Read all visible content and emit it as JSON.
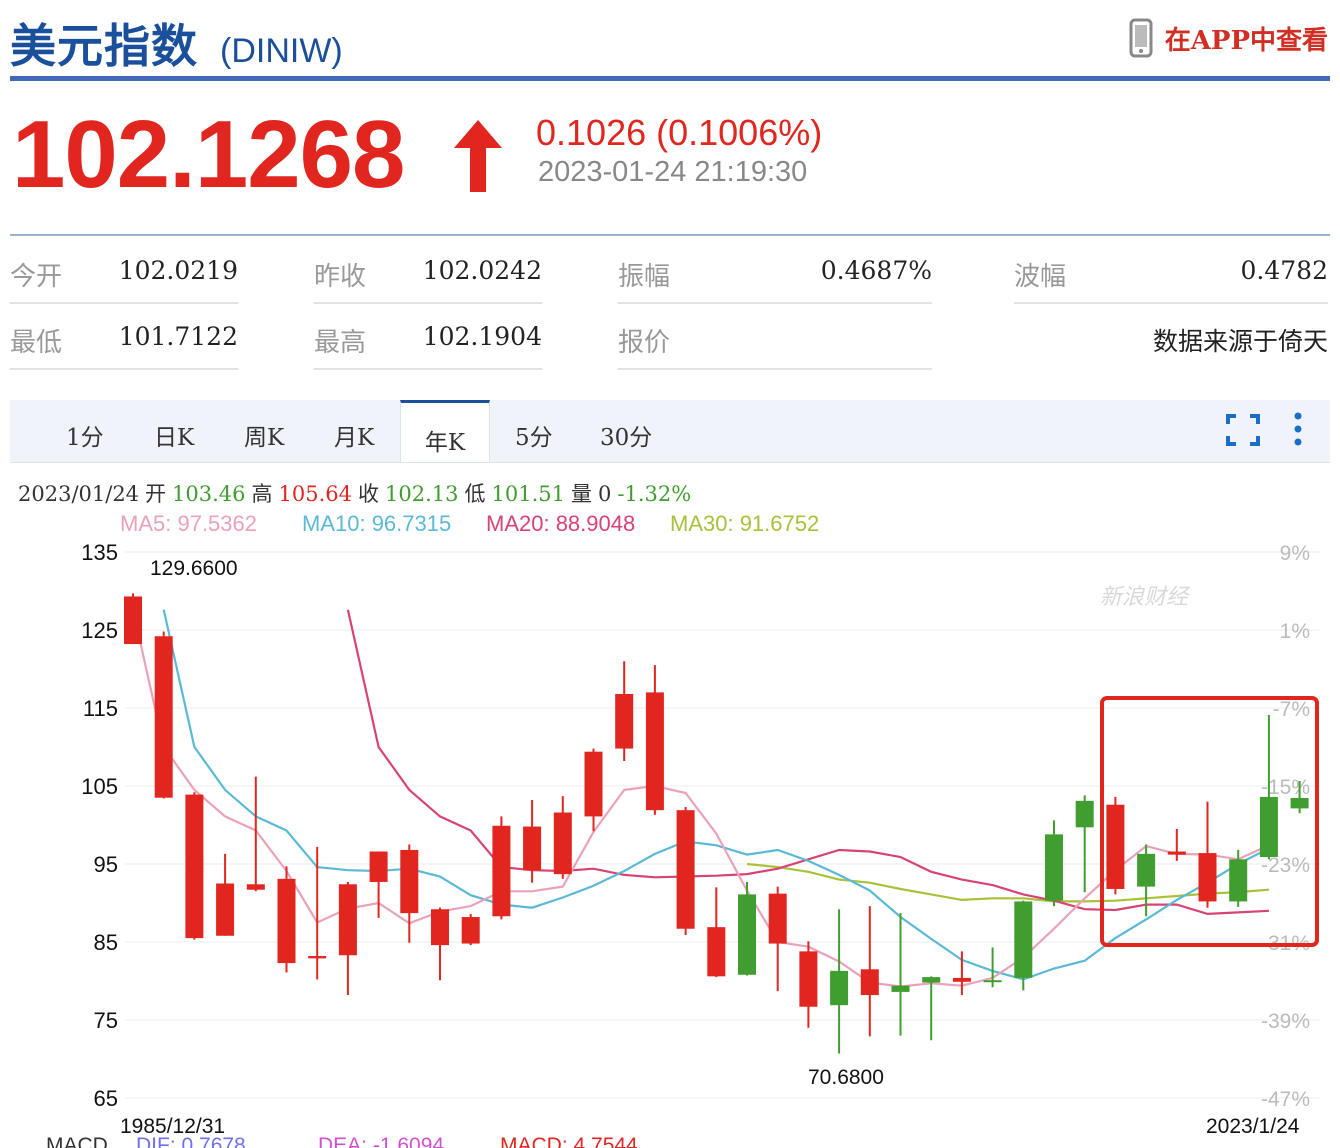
{
  "header": {
    "title": "美元指数",
    "code": "(DINIW)",
    "app_link": "在APP中查看",
    "price": "102.1268",
    "change": "0.1026 (0.1006%)",
    "time": "2023-01-24 21:19:30"
  },
  "stats": [
    {
      "label": "今开",
      "value": "102.0219"
    },
    {
      "label": "昨收",
      "value": "102.0242"
    },
    {
      "label": "振幅",
      "value": "0.4687%"
    },
    {
      "label": "波幅",
      "value": "0.4782"
    },
    {
      "label": "最低",
      "value": "101.7122"
    },
    {
      "label": "最高",
      "value": "102.1904"
    },
    {
      "label": "报价",
      "value": ""
    },
    {
      "label": "",
      "value": "数据来源于倚天"
    }
  ],
  "tabs": [
    "1分",
    "日K",
    "周K",
    "月K",
    "年K",
    "5分",
    "30分"
  ],
  "ohlc": {
    "date": "2023/01/24",
    "open_label": "开",
    "open": "103.46",
    "high_label": "高",
    "high": "105.64",
    "close_label": "收",
    "close": "102.13",
    "low_label": "低",
    "low": "101.51",
    "vol_label": "量",
    "vol": "0",
    "pct": "-1.32%"
  },
  "ma": {
    "ma5": "MA5: 97.5362",
    "ma10": "MA10: 96.7315",
    "ma20": "MA20: 88.9048",
    "ma30": "MA30: 91.6752"
  },
  "watermark": "新浪财经",
  "macd": {
    "label": "MACD",
    "dif": "DIF: 0.7678",
    "dea": "DEA: -1.6094",
    "macd": "MACD: 4.7544"
  },
  "colors": {
    "up": "#e0261f",
    "down": "#3f9e2f",
    "ma5": "#eba0bb",
    "ma10": "#5ab9d6",
    "ma20": "#d84375",
    "ma30": "#a7c23a",
    "accent": "#1a4f9c"
  },
  "chart_data": {
    "type": "candlestick",
    "x_start_label": "1985/12/31",
    "x_end_label": "2023/1/24",
    "y_ticks": [
      135,
      125,
      115,
      105,
      95,
      85,
      75,
      65
    ],
    "y_ticks_right": [
      "9%",
      "1%",
      "-7%",
      "-15%",
      "-23%",
      "-31%",
      "-39%",
      "-47%"
    ],
    "ylim": [
      65,
      135
    ],
    "max_label": "129.6600",
    "min_label": "70.6800",
    "candles": [
      {
        "o": 123.2,
        "h": 129.7,
        "l": 123.2,
        "c": 129.3
      },
      {
        "o": 103.5,
        "h": 124.8,
        "l": 103.4,
        "c": 124.2
      },
      {
        "o": 85.5,
        "h": 104.2,
        "l": 85.3,
        "c": 103.9
      },
      {
        "o": 85.8,
        "h": 96.3,
        "l": 85.8,
        "c": 92.5
      },
      {
        "o": 91.7,
        "h": 106.2,
        "l": 91.5,
        "c": 92.4
      },
      {
        "o": 82.3,
        "h": 94.7,
        "l": 81.1,
        "c": 93.1
      },
      {
        "o": 82.9,
        "h": 97.2,
        "l": 80.2,
        "c": 83.2
      },
      {
        "o": 83.3,
        "h": 92.7,
        "l": 78.2,
        "c": 92.4
      },
      {
        "o": 92.7,
        "h": 96.5,
        "l": 88.1,
        "c": 96.6
      },
      {
        "o": 88.7,
        "h": 97.5,
        "l": 84.9,
        "c": 96.8
      },
      {
        "o": 84.6,
        "h": 89.4,
        "l": 80.1,
        "c": 89.2
      },
      {
        "o": 84.8,
        "h": 88.6,
        "l": 84.6,
        "c": 88.2
      },
      {
        "o": 88.3,
        "h": 101.1,
        "l": 87.9,
        "c": 99.9
      },
      {
        "o": 94.2,
        "h": 103.2,
        "l": 92.6,
        "c": 99.8
      },
      {
        "o": 93.7,
        "h": 103.7,
        "l": 93.1,
        "c": 101.6
      },
      {
        "o": 101.1,
        "h": 109.8,
        "l": 99.2,
        "c": 109.4
      },
      {
        "o": 109.8,
        "h": 121.0,
        "l": 108.2,
        "c": 116.8
      },
      {
        "o": 101.9,
        "h": 120.5,
        "l": 101.3,
        "c": 117.0
      },
      {
        "o": 86.7,
        "h": 102.3,
        "l": 85.9,
        "c": 101.9
      },
      {
        "o": 80.6,
        "h": 92.0,
        "l": 80.5,
        "c": 86.9
      },
      {
        "o": 91.1,
        "h": 92.7,
        "l": 80.7,
        "c": 80.8
      },
      {
        "o": 84.8,
        "h": 92.1,
        "l": 78.7,
        "c": 91.2
      },
      {
        "o": 76.7,
        "h": 85.1,
        "l": 74.0,
        "c": 83.8
      },
      {
        "o": 81.3,
        "h": 89.2,
        "l": 70.7,
        "c": 76.9
      },
      {
        "o": 78.2,
        "h": 89.6,
        "l": 72.9,
        "c": 81.5
      },
      {
        "o": 79.4,
        "h": 88.7,
        "l": 73.0,
        "c": 78.6
      },
      {
        "o": 80.5,
        "h": 80.6,
        "l": 72.4,
        "c": 79.8
      },
      {
        "o": 79.9,
        "h": 83.8,
        "l": 78.2,
        "c": 80.4
      },
      {
        "o": 80.1,
        "h": 84.3,
        "l": 79.2,
        "c": 80.0
      },
      {
        "o": 90.2,
        "h": 90.3,
        "l": 78.8,
        "c": 80.4
      },
      {
        "o": 98.8,
        "h": 100.6,
        "l": 89.6,
        "c": 90.3
      },
      {
        "o": 103.1,
        "h": 103.8,
        "l": 91.4,
        "c": 99.7
      },
      {
        "o": 91.8,
        "h": 103.6,
        "l": 91.1,
        "c": 102.6
      },
      {
        "o": 96.3,
        "h": 97.5,
        "l": 88.3,
        "c": 92.1
      },
      {
        "o": 96.2,
        "h": 99.5,
        "l": 95.4,
        "c": 96.6
      },
      {
        "o": 90.2,
        "h": 103.0,
        "l": 89.4,
        "c": 96.4
      },
      {
        "o": 95.6,
        "h": 96.8,
        "l": 89.5,
        "c": 90.2
      },
      {
        "o": 103.6,
        "h": 114.1,
        "l": 95.6,
        "c": 95.9
      },
      {
        "o": 103.46,
        "h": 105.64,
        "l": 101.51,
        "c": 102.13
      }
    ],
    "ma5": [
      127.6,
      110.0,
      104.5,
      101.1,
      99.3,
      94.1,
      87.5,
      89.3,
      90.0,
      87.4,
      88.9,
      89.6,
      91.5,
      91.5,
      92.1,
      99.1,
      104.5,
      105.0,
      104.1,
      98.9,
      91.6,
      85.0,
      84.4,
      82.5,
      79.8,
      79.3,
      79.7,
      79.4,
      80.4,
      83.0,
      86.7,
      90.6,
      94.2,
      97.3,
      96.3,
      96.2,
      95.6,
      97.4
    ],
    "ma10": [
      127.6,
      110.0,
      104.5,
      101.1,
      99.3,
      94.6,
      94.2,
      94.1,
      94.4,
      93.4,
      91.0,
      89.8,
      89.4,
      90.7,
      92.2,
      94.1,
      96.3,
      97.9,
      97.4,
      96.2,
      96.8,
      95.4,
      93.6,
      91.6,
      88.2,
      85.4,
      82.7,
      81.3,
      80.2,
      81.6,
      82.6,
      85.5,
      87.9,
      90.4,
      92.6,
      95.0,
      97.0
    ],
    "ma20": [
      127.6,
      110.0,
      104.5,
      101.1,
      99.3,
      94.6,
      94.2,
      94.1,
      94.4,
      93.6,
      93.3,
      93.4,
      93.5,
      93.7,
      94.4,
      95.6,
      96.8,
      96.6,
      95.9,
      94.0,
      93.0,
      92.3,
      91.1,
      90.3,
      89.2,
      89.1,
      89.8,
      89.8,
      88.6,
      88.8,
      89.0
    ],
    "ma30": [
      95.0,
      94.6,
      94.0,
      93.0,
      92.6,
      91.8,
      91.1,
      90.4,
      90.6,
      90.6,
      90.2,
      90.2,
      90.3,
      90.6,
      90.9,
      91.2,
      91.4,
      91.7
    ]
  }
}
